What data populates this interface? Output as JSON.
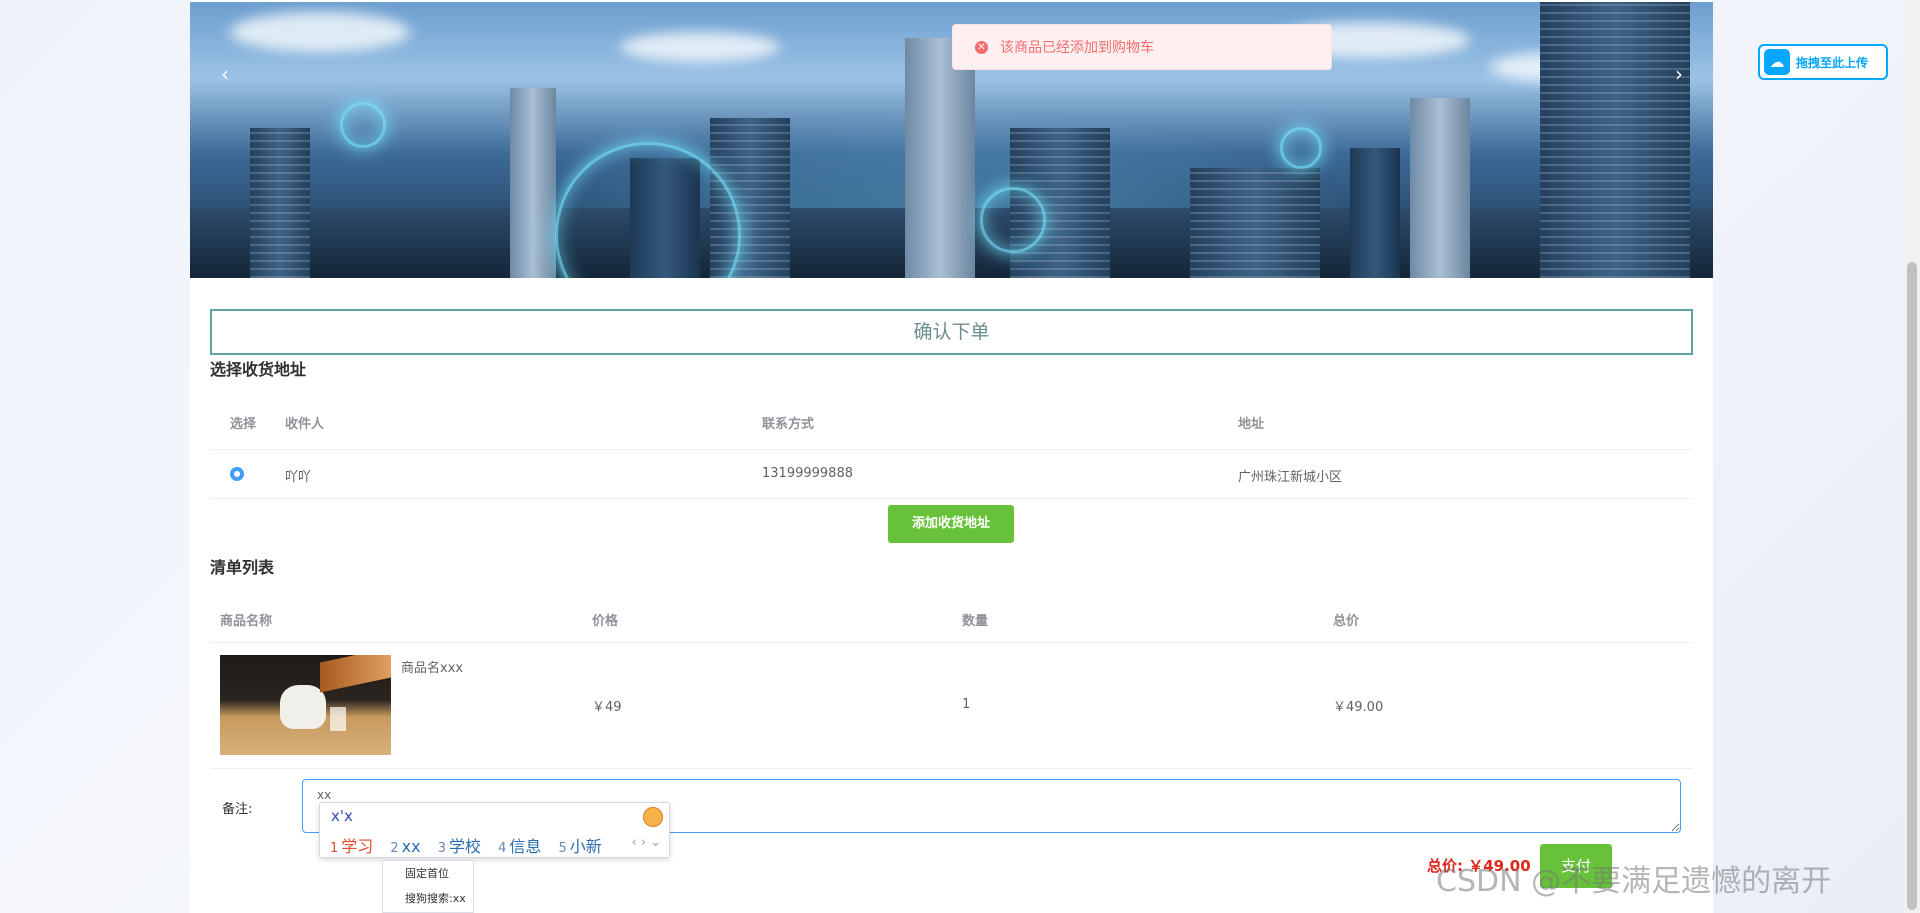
{
  "banner": {
    "prev_arrow": "‹",
    "next_arrow": "›"
  },
  "toast": {
    "message": "该商品已经添加到购物车",
    "icon": "error-circle-icon"
  },
  "upload": {
    "label": "拖拽至此上传",
    "icon": "cloud-icon"
  },
  "page": {
    "title": "确认下单"
  },
  "address": {
    "section_title": "选择收货地址",
    "columns": [
      "选择",
      "收件人",
      "联系方式",
      "地址"
    ],
    "rows": [
      {
        "recipient": "吖吖",
        "phone": "13199999888",
        "address": "广州珠江新城小区",
        "selected": true
      }
    ],
    "add_button": "添加收货地址"
  },
  "order": {
    "section_title": "清单列表",
    "columns": [
      "商品名称",
      "价格",
      "数量",
      "总价"
    ],
    "items": [
      {
        "name": "商品名xxx",
        "price": "￥49",
        "quantity": "1",
        "total": "￥49.00"
      }
    ]
  },
  "remark": {
    "label": "备注:",
    "value": "xx"
  },
  "ime": {
    "composition": "x'x",
    "candidates": [
      {
        "num": "1",
        "text": "学习"
      },
      {
        "num": "2",
        "text": "xx"
      },
      {
        "num": "3",
        "text": "学校"
      },
      {
        "num": "4",
        "text": "信息"
      },
      {
        "num": "5",
        "text": "小新"
      }
    ],
    "nav": "‹ › ⌄",
    "menu": [
      "固定首位",
      "搜狗搜索:xx"
    ]
  },
  "summary": {
    "total_label": "总价: ￥49.00",
    "pay_button": "支付"
  },
  "watermark": "CSDN @不要满足遗憾的离开",
  "colors": {
    "primary": "#409eff",
    "success": "#67c23a",
    "danger": "#e1251b",
    "upload_blue": "#06a7ff"
  }
}
